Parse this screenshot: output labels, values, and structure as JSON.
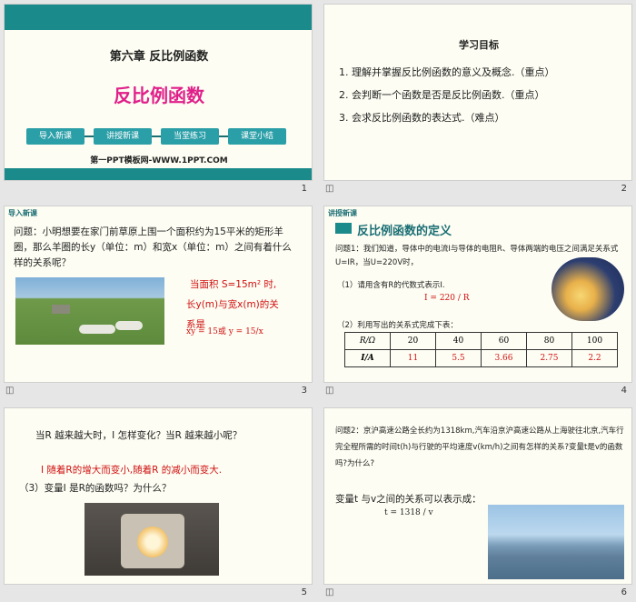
{
  "slides": [
    {
      "number": "1",
      "chapter": "第六章 反比例函数",
      "title": "反比例函数",
      "nav": [
        "导入新课",
        "讲授新课",
        "当堂练习",
        "课堂小结"
      ],
      "site": "第一PPT模板网-WWW.1PPT.COM"
    },
    {
      "number": "2",
      "heading": "学习目标",
      "items": [
        "1. 理解并掌握反比例函数的意义及概念.（重点）",
        "2. 会判断一个函数是否是反比例函数.（重点）",
        "3. 会求反比例函数的表达式.（难点）"
      ]
    },
    {
      "number": "3",
      "tag": "导入新课",
      "question": "问题：小明想要在家门前草原上围一个面积约为15平米的矩形羊圈，那么羊圈的长y（单位：m）和宽x（单位：m）之间有着什么样的关系呢？",
      "answer1": "当面积 S=15m² 时,",
      "answer2": "长y(m)与宽x(m)的关",
      "answer3": "系是",
      "formula": "xy = 15或 y = 15/x"
    },
    {
      "number": "4",
      "tag": "讲授新课",
      "section_title": "反比例函数的定义",
      "question": "问题1：我们知道，导体中的电流I与导体的电阻R、导体两端的电压之间满足关系式U=IR，当U=220V时，",
      "q1": "（1）请用含有R的代数式表示I.",
      "formula": "I = 220 / R",
      "q2": "（2）利用写出的关系式完成下表：",
      "table": {
        "header": [
          "R/Ω",
          "20",
          "40",
          "60",
          "80",
          "100"
        ],
        "row": [
          "I/A",
          "11",
          "5.5",
          "3.66",
          "2.75",
          "2.2"
        ]
      }
    },
    {
      "number": "5",
      "line1": "当R 越来越大时，I 怎样变化？当R 越来越小呢？",
      "line2": "I 随着R的增大而变小,随着R 的减小而变大.",
      "line3": "（3）变量I 是R的函数吗？为什么？"
    },
    {
      "number": "6",
      "question": "问题2：京沪高速公路全长约为1318km,汽车沿京沪高速公路从上海驶往北京,汽车行完全程所需的时间t(h)与行驶的平均速度v(km/h)之间有怎样的关系?变量t是v的函数吗?为什么?",
      "relation": "变量t 与v之间的关系可以表示成：",
      "formula": "t = 1318 / v"
    }
  ],
  "colors": {
    "teal": "#1a8a8a",
    "accent_red": "#d01010",
    "magenta": "#e0208a"
  }
}
